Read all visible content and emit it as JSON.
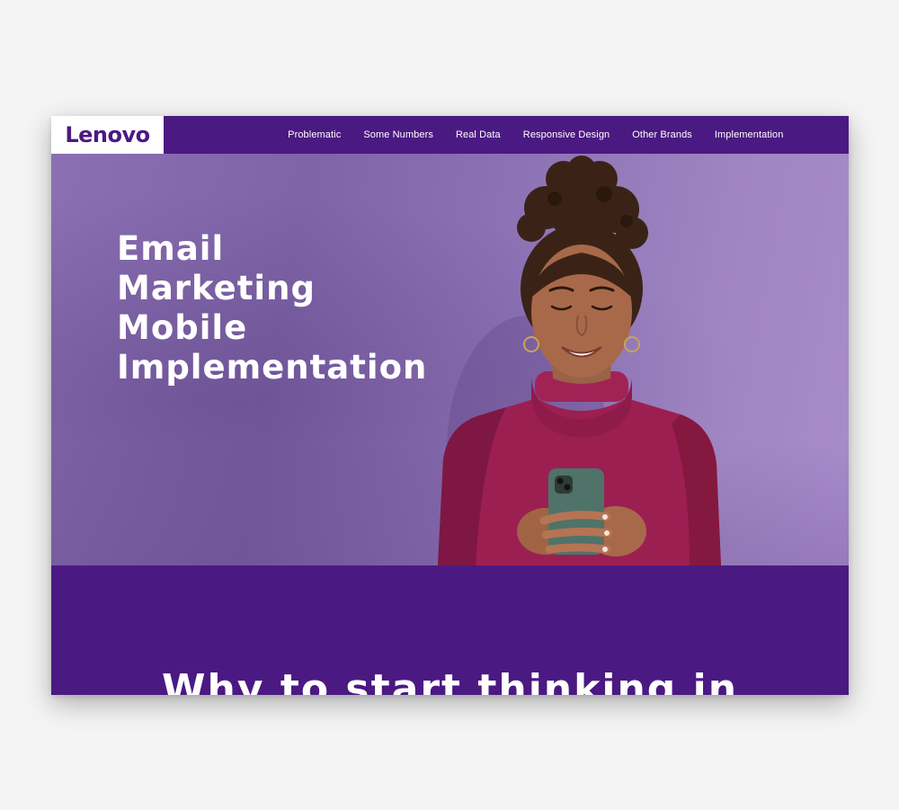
{
  "brand": {
    "logo_text": "Lenovo",
    "color_primary": "#4b1982",
    "color_logo_bg": "#ffffff"
  },
  "nav": {
    "items": [
      {
        "label": "Problematic"
      },
      {
        "label": "Some Numbers"
      },
      {
        "label": "Real Data"
      },
      {
        "label": "Responsive Design"
      },
      {
        "label": "Other Brands"
      },
      {
        "label": "Implementation"
      }
    ]
  },
  "hero": {
    "title_lines": [
      "Email",
      "Marketing",
      "Mobile",
      "Implementation"
    ],
    "image": "woman-smiling-at-phone-photo"
  },
  "section": {
    "heading": "Why to start thinking in"
  }
}
